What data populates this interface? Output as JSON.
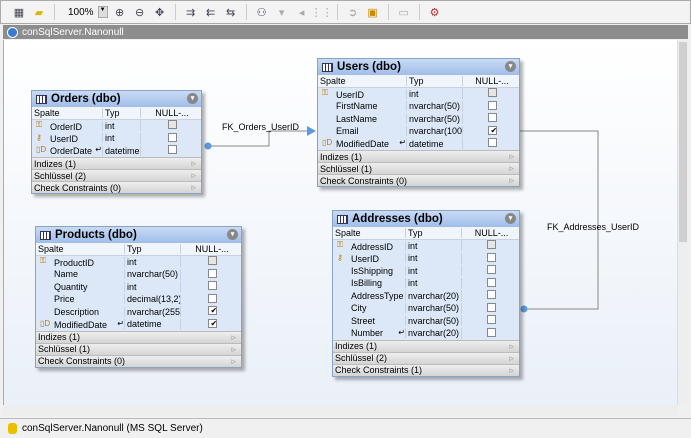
{
  "toolbar": {
    "zoom": "100%",
    "icons": [
      "new-table-icon",
      "open-icon",
      "zoom-in-icon",
      "zoom-out-icon",
      "fit-icon",
      "layout-icon",
      "hierarchy-icon",
      "grid-icon",
      "export-icon",
      "properties-icon"
    ]
  },
  "tab": {
    "title": "conSqlServer.Nanonull"
  },
  "status": {
    "text": "conSqlServer.Nanonull (MS SQL Server)"
  },
  "col_headers": {
    "name": "Spalte",
    "type": "Typ",
    "null": "NULL-..."
  },
  "tables": [
    {
      "id": "orders",
      "title": "Orders (dbo)",
      "rows": [
        {
          "name": "OrderID",
          "type": "int",
          "null": false,
          "key": "pk-fk",
          "disabled": true
        },
        {
          "name": "UserID",
          "type": "int",
          "null": false,
          "key": "fk"
        },
        {
          "name": "OrderDate",
          "type": "datetime",
          "null": false,
          "key": "default",
          "expr": true
        }
      ],
      "sections": [
        "Indizes (1)",
        "Schlüssel (2)",
        "Check Constraints (0)"
      ]
    },
    {
      "id": "users",
      "title": "Users (dbo)",
      "rows": [
        {
          "name": "UserID",
          "type": "int",
          "null": false,
          "key": "pk",
          "disabled": true
        },
        {
          "name": "FirstName",
          "type": "nvarchar(50)",
          "null": false
        },
        {
          "name": "LastName",
          "type": "nvarchar(50)",
          "null": false
        },
        {
          "name": "Email",
          "type": "nvarchar(100)",
          "null": true
        },
        {
          "name": "ModifiedDate",
          "type": "datetime",
          "null": false,
          "key": "default",
          "expr": true
        }
      ],
      "sections": [
        "Indizes (1)",
        "Schlüssel (1)",
        "Check Constraints (0)"
      ]
    },
    {
      "id": "products",
      "title": "Products (dbo)",
      "rows": [
        {
          "name": "ProductID",
          "type": "int",
          "null": false,
          "key": "pk",
          "disabled": true
        },
        {
          "name": "Name",
          "type": "nvarchar(50)",
          "null": false
        },
        {
          "name": "Quantity",
          "type": "int",
          "null": false
        },
        {
          "name": "Price",
          "type": "decimal(13,2)",
          "null": false
        },
        {
          "name": "Description",
          "type": "nvarchar(255)",
          "null": true
        },
        {
          "name": "ModifiedDate",
          "type": "datetime",
          "null": true,
          "key": "default",
          "expr": true
        }
      ],
      "sections": [
        "Indizes (1)",
        "Schlüssel (1)",
        "Check Constraints (0)"
      ]
    },
    {
      "id": "addresses",
      "title": "Addresses (dbo)",
      "rows": [
        {
          "name": "AddressID",
          "type": "int",
          "null": false,
          "key": "pk",
          "disabled": true
        },
        {
          "name": "UserID",
          "type": "int",
          "null": false,
          "key": "fk"
        },
        {
          "name": "IsShipping",
          "type": "int",
          "null": false
        },
        {
          "name": "IsBilling",
          "type": "int",
          "null": false
        },
        {
          "name": "AddressType",
          "type": "nvarchar(20)",
          "null": false
        },
        {
          "name": "City",
          "type": "nvarchar(50)",
          "null": false
        },
        {
          "name": "Street",
          "type": "nvarchar(50)",
          "null": false
        },
        {
          "name": "Number",
          "type": "nvarchar(20)",
          "null": false,
          "expr": true
        }
      ],
      "sections": [
        "Indizes (1)",
        "Schlüssel (2)",
        "Check Constraints (1)"
      ]
    }
  ],
  "relations": [
    {
      "label": "FK_Orders_UserID"
    },
    {
      "label": "FK_Addresses_UserID"
    }
  ]
}
